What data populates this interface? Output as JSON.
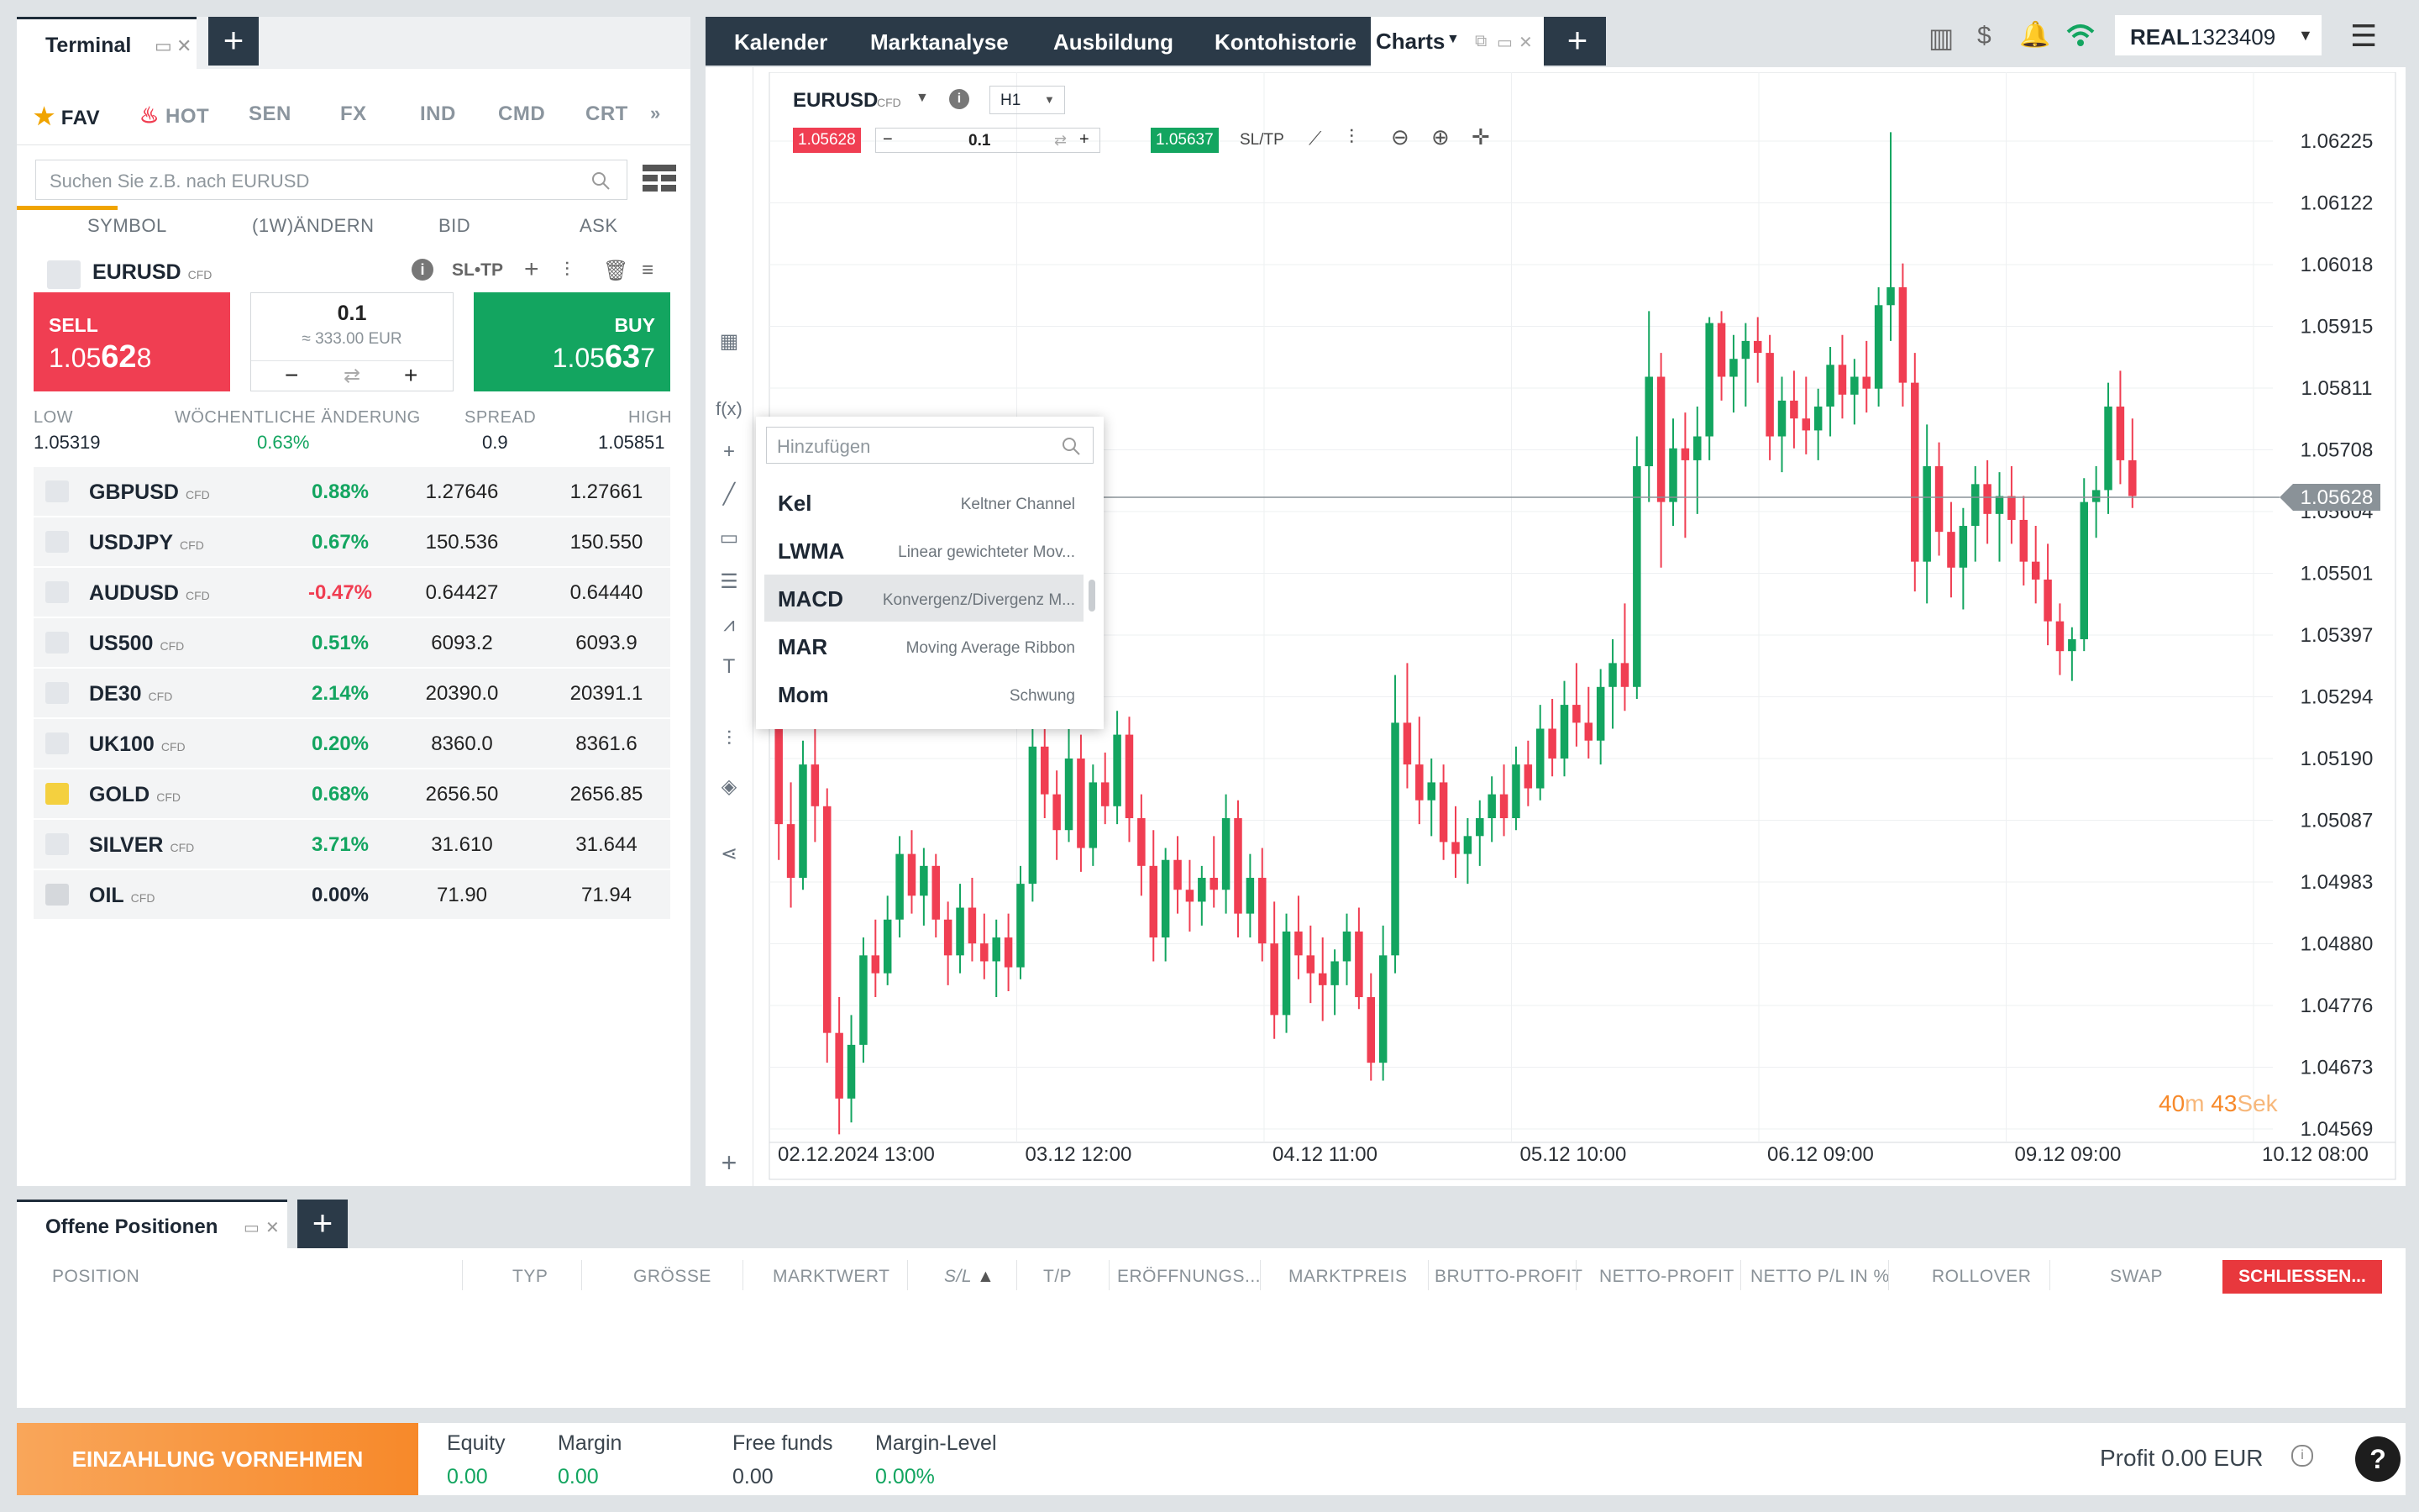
{
  "terminal": {
    "tab_title": "Terminal"
  },
  "categories": [
    {
      "label": "FAV",
      "icon": "star-icon",
      "active": true
    },
    {
      "label": "HOT",
      "icon": "flame-icon"
    },
    {
      "label": "SEN"
    },
    {
      "label": "FX"
    },
    {
      "label": "IND"
    },
    {
      "label": "CMD"
    },
    {
      "label": "CRT"
    }
  ],
  "search": {
    "placeholder": "Suchen Sie z.B. nach EURUSD"
  },
  "columns": {
    "symbol": "SYMBOL",
    "change": "(1W)ÄNDERN",
    "bid": "BID",
    "ask": "ASK"
  },
  "selected": {
    "symbol": "EURUSD",
    "type": "CFD",
    "sltp": "SL•TP",
    "sell_label": "SELL",
    "sell_price_pre": "1.05",
    "sell_price_big": "62",
    "sell_price_post": "8",
    "buy_label": "BUY",
    "buy_price_pre": "1.05",
    "buy_price_big": "63",
    "buy_price_post": "7",
    "volume": "0.1",
    "volume_eur": "≈ 333.00 EUR",
    "minus": "−",
    "plus": "+",
    "low_label": "LOW",
    "low": "1.05319",
    "weekchange_label": "WÖCHENTLICHE ÄNDERUNG",
    "weekchange": "0.63%",
    "spread_label": "SPREAD",
    "spread": "0.9",
    "high_label": "HIGH",
    "high": "1.05851"
  },
  "markets": [
    {
      "name": "GBPUSD",
      "type": "CFD",
      "change": "0.88%",
      "bid": "1.27646",
      "ask": "1.27661",
      "dir": "pos"
    },
    {
      "name": "USDJPY",
      "type": "CFD",
      "change": "0.67%",
      "bid": "150.536",
      "ask": "150.550",
      "dir": "pos"
    },
    {
      "name": "AUDUSD",
      "type": "CFD",
      "change": "-0.47%",
      "bid": "0.64427",
      "ask": "0.64440",
      "dir": "neg"
    },
    {
      "name": "US500",
      "type": "CFD",
      "change": "0.51%",
      "bid": "6093.2",
      "ask": "6093.9",
      "dir": "pos"
    },
    {
      "name": "DE30",
      "type": "CFD",
      "change": "2.14%",
      "bid": "20390.0",
      "ask": "20391.1",
      "dir": "pos"
    },
    {
      "name": "UK100",
      "type": "CFD",
      "change": "0.20%",
      "bid": "8360.0",
      "ask": "8361.6",
      "dir": "pos"
    },
    {
      "name": "GOLD",
      "type": "CFD",
      "change": "0.68%",
      "bid": "2656.50",
      "ask": "2656.85",
      "dir": "pos"
    },
    {
      "name": "SILVER",
      "type": "CFD",
      "change": "3.71%",
      "bid": "31.610",
      "ask": "31.644",
      "dir": "pos"
    },
    {
      "name": "OIL",
      "type": "CFD",
      "change": "0.00%",
      "bid": "71.90",
      "ask": "71.94",
      "dir": "neu"
    }
  ],
  "nav": {
    "items": [
      "Kalender",
      "Marktanalyse",
      "Ausbildung",
      "Kontohistorie"
    ],
    "charts_tab": "Charts",
    "account_type": "REAL",
    "account_number": "1323409"
  },
  "chart_toolbar": {
    "symbol": "EURUSD",
    "type": "CFD",
    "timeframe": "H1",
    "sell_price": "1.05628",
    "buy_price": "1.05637",
    "volume": "0.1",
    "sltp": "SL/TP"
  },
  "indicator_popup": {
    "placeholder": "Hinzufügen",
    "items": [
      {
        "name": "Kel",
        "desc": "Keltner Channel"
      },
      {
        "name": "LWMA",
        "desc": "Linear gewichteter Mov..."
      },
      {
        "name": "MACD",
        "desc": "Konvergenz/Divergenz M...",
        "highlight": true
      },
      {
        "name": "MAR",
        "desc": "Moving Average Ribbon"
      },
      {
        "name": "Mom",
        "desc": "Schwung"
      }
    ]
  },
  "countdown": {
    "minutes": "40",
    "m": "m",
    "seconds": "43",
    "sek": "Sek"
  },
  "chart_data": {
    "type": "candlestick",
    "current_price": "1.05628",
    "y_ticks": [
      "1.06225",
      "1.06122",
      "1.06018",
      "1.05915",
      "1.05811",
      "1.05708",
      "1.05604",
      "1.05501",
      "1.05397",
      "1.05294",
      "1.05190",
      "1.05087",
      "1.04983",
      "1.04880",
      "1.04776",
      "1.04673",
      "1.04569"
    ],
    "ylim": [
      1.04569,
      1.06225
    ],
    "x_ticks": [
      "02.12.2024 13:00",
      "03.12 12:00",
      "04.12 11:00",
      "05.12 10:00",
      "06.12 09:00",
      "09.12 09:00",
      "10.12 08:00"
    ],
    "grid": true,
    "candles": [
      [
        1.0525,
        1.0531,
        1.0502,
        1.0508
      ],
      [
        1.0508,
        1.0515,
        1.0494,
        1.0499
      ],
      [
        1.0499,
        1.0522,
        1.0497,
        1.0518
      ],
      [
        1.0518,
        1.0524,
        1.0505,
        1.0511
      ],
      [
        1.0511,
        1.0514,
        1.0468,
        1.0473
      ],
      [
        1.0473,
        1.0479,
        1.0456,
        1.0462
      ],
      [
        1.0462,
        1.0476,
        1.0458,
        1.0471
      ],
      [
        1.0471,
        1.0489,
        1.0468,
        1.0486
      ],
      [
        1.0486,
        1.0492,
        1.0479,
        1.0483
      ],
      [
        1.0483,
        1.0496,
        1.0481,
        1.0492
      ],
      [
        1.0492,
        1.0506,
        1.0489,
        1.0503
      ],
      [
        1.0503,
        1.0507,
        1.0493,
        1.0496
      ],
      [
        1.0496,
        1.0504,
        1.0491,
        1.0501
      ],
      [
        1.0501,
        1.0503,
        1.0489,
        1.0492
      ],
      [
        1.0492,
        1.0495,
        1.0481,
        1.0486
      ],
      [
        1.0486,
        1.0498,
        1.0483,
        1.0494
      ],
      [
        1.0494,
        1.0499,
        1.0485,
        1.0488
      ],
      [
        1.0488,
        1.0493,
        1.0482,
        1.0485
      ],
      [
        1.0485,
        1.0492,
        1.0479,
        1.0489
      ],
      [
        1.0489,
        1.0493,
        1.048,
        1.0484
      ],
      [
        1.0484,
        1.0501,
        1.0482,
        1.0498
      ],
      [
        1.0498,
        1.0524,
        1.0495,
        1.0521
      ],
      [
        1.0521,
        1.0528,
        1.0509,
        1.0513
      ],
      [
        1.0513,
        1.0517,
        1.0502,
        1.0507
      ],
      [
        1.0507,
        1.0524,
        1.0505,
        1.0519
      ],
      [
        1.0519,
        1.0523,
        1.05,
        1.0504
      ],
      [
        1.0504,
        1.0518,
        1.0501,
        1.0515
      ],
      [
        1.0515,
        1.052,
        1.0508,
        1.0511
      ],
      [
        1.0511,
        1.0527,
        1.0508,
        1.0523
      ],
      [
        1.0523,
        1.0526,
        1.0505,
        1.0509
      ],
      [
        1.0509,
        1.0513,
        1.0496,
        1.0501
      ],
      [
        1.0501,
        1.0507,
        1.0485,
        1.0489
      ],
      [
        1.0489,
        1.0504,
        1.0485,
        1.0502
      ],
      [
        1.0502,
        1.0506,
        1.0493,
        1.0497
      ],
      [
        1.0497,
        1.0502,
        1.049,
        1.0495
      ],
      [
        1.0495,
        1.0501,
        1.0491,
        1.0499
      ],
      [
        1.0499,
        1.0506,
        1.0494,
        1.0497
      ],
      [
        1.0497,
        1.0513,
        1.0493,
        1.0509
      ],
      [
        1.0509,
        1.0512,
        1.0489,
        1.0493
      ],
      [
        1.0493,
        1.0503,
        1.0489,
        1.0499
      ],
      [
        1.0499,
        1.0504,
        1.0485,
        1.0488
      ],
      [
        1.0488,
        1.0495,
        1.0472,
        1.0476
      ],
      [
        1.0476,
        1.0493,
        1.0473,
        1.049
      ],
      [
        1.049,
        1.0496,
        1.0482,
        1.0486
      ],
      [
        1.0486,
        1.0491,
        1.0478,
        1.0483
      ],
      [
        1.0483,
        1.0489,
        1.0475,
        1.0481
      ],
      [
        1.0481,
        1.0487,
        1.0476,
        1.0485
      ],
      [
        1.0485,
        1.0493,
        1.0481,
        1.049
      ],
      [
        1.049,
        1.0494,
        1.0477,
        1.0479
      ],
      [
        1.0479,
        1.0483,
        1.0465,
        1.0468
      ],
      [
        1.0468,
        1.0491,
        1.0465,
        1.0486
      ],
      [
        1.0486,
        1.0533,
        1.0483,
        1.0525
      ],
      [
        1.0525,
        1.0535,
        1.0514,
        1.0518
      ],
      [
        1.0518,
        1.0526,
        1.0508,
        1.0512
      ],
      [
        1.0512,
        1.0519,
        1.0506,
        1.0515
      ],
      [
        1.0515,
        1.0518,
        1.0502,
        1.0505
      ],
      [
        1.0505,
        1.0511,
        1.0499,
        1.0503
      ],
      [
        1.0503,
        1.0509,
        1.0498,
        1.0506
      ],
      [
        1.0506,
        1.0512,
        1.0501,
        1.0509
      ],
      [
        1.0509,
        1.0516,
        1.0505,
        1.0513
      ],
      [
        1.0513,
        1.0518,
        1.0506,
        1.0509
      ],
      [
        1.0509,
        1.0521,
        1.0507,
        1.0518
      ],
      [
        1.0518,
        1.0522,
        1.0511,
        1.0514
      ],
      [
        1.0514,
        1.0528,
        1.0512,
        1.0524
      ],
      [
        1.0524,
        1.0529,
        1.0516,
        1.0519
      ],
      [
        1.0519,
        1.0532,
        1.0516,
        1.0528
      ],
      [
        1.0528,
        1.0535,
        1.0521,
        1.0525
      ],
      [
        1.0525,
        1.0531,
        1.0519,
        1.0522
      ],
      [
        1.0522,
        1.0534,
        1.0518,
        1.0531
      ],
      [
        1.0531,
        1.0539,
        1.0524,
        1.0535
      ],
      [
        1.0535,
        1.0545,
        1.0527,
        1.0531
      ],
      [
        1.0531,
        1.0573,
        1.0529,
        1.0568
      ],
      [
        1.0568,
        1.0594,
        1.0562,
        1.0583
      ],
      [
        1.0583,
        1.0587,
        1.0551,
        1.0562
      ],
      [
        1.0562,
        1.0576,
        1.0558,
        1.0571
      ],
      [
        1.0571,
        1.0577,
        1.0556,
        1.0569
      ],
      [
        1.0569,
        1.0578,
        1.056,
        1.0573
      ],
      [
        1.0573,
        1.0593,
        1.0569,
        1.0592
      ],
      [
        1.0592,
        1.0594,
        1.0579,
        1.0583
      ],
      [
        1.0583,
        1.059,
        1.0577,
        1.0586
      ],
      [
        1.0586,
        1.0592,
        1.0578,
        1.0589
      ],
      [
        1.0589,
        1.0593,
        1.0582,
        1.0587
      ],
      [
        1.0587,
        1.059,
        1.0569,
        1.0573
      ],
      [
        1.0573,
        1.0583,
        1.0567,
        1.0579
      ],
      [
        1.0579,
        1.0584,
        1.0571,
        1.0576
      ],
      [
        1.0576,
        1.0583,
        1.057,
        1.0574
      ],
      [
        1.0574,
        1.0581,
        1.0569,
        1.0578
      ],
      [
        1.0578,
        1.0588,
        1.0573,
        1.0585
      ],
      [
        1.0585,
        1.059,
        1.0576,
        1.058
      ],
      [
        1.058,
        1.0586,
        1.0575,
        1.0583
      ],
      [
        1.0583,
        1.0589,
        1.0577,
        1.0581
      ],
      [
        1.0581,
        1.0598,
        1.0578,
        1.0595
      ],
      [
        1.0595,
        1.0624,
        1.0589,
        1.0598
      ],
      [
        1.0598,
        1.0602,
        1.0578,
        1.0582
      ],
      [
        1.0582,
        1.0587,
        1.0547,
        1.0552
      ],
      [
        1.0552,
        1.0575,
        1.0545,
        1.0568
      ],
      [
        1.0568,
        1.0572,
        1.0553,
        1.0557
      ],
      [
        1.0557,
        1.0562,
        1.0546,
        1.0551
      ],
      [
        1.0551,
        1.0561,
        1.0544,
        1.0558
      ],
      [
        1.0558,
        1.0568,
        1.0552,
        1.0565
      ],
      [
        1.0565,
        1.0569,
        1.0555,
        1.056
      ],
      [
        1.056,
        1.0567,
        1.0552,
        1.0563
      ],
      [
        1.0563,
        1.0568,
        1.0555,
        1.0559
      ],
      [
        1.0559,
        1.0563,
        1.0548,
        1.0552
      ],
      [
        1.0552,
        1.0558,
        1.0545,
        1.0549
      ],
      [
        1.0549,
        1.0555,
        1.0538,
        1.0542
      ],
      [
        1.0542,
        1.0545,
        1.0533,
        1.0537
      ],
      [
        1.0537,
        1.0541,
        1.0532,
        1.0539
      ],
      [
        1.0539,
        1.0566,
        1.0537,
        1.0562
      ],
      [
        1.0562,
        1.0568,
        1.0556,
        1.0564
      ],
      [
        1.0564,
        1.0582,
        1.056,
        1.0578
      ],
      [
        1.0578,
        1.0584,
        1.0565,
        1.0569
      ],
      [
        1.0569,
        1.0576,
        1.0561,
        1.0563
      ]
    ]
  },
  "positions": {
    "tab_title": "Offene Positionen",
    "columns": [
      "POSITION",
      "TYP",
      "GRÖSSE",
      "MARKTWERT",
      "S/L",
      "T/P",
      "ERÖFFNUNGS...",
      "MARKTPREIS",
      "BRUTTO-PROFIT",
      "NETTO-PROFIT",
      "NETTO P/L IN %",
      "ROLLOVER",
      "SWAP"
    ],
    "close_button": "SCHLIESSEN..."
  },
  "footer": {
    "deposit_button": "EINZAHLUNG VORNEHMEN",
    "equity_label": "Equity",
    "equity": "0.00",
    "margin_label": "Margin",
    "margin": "0.00",
    "free_label": "Free funds",
    "free": "0.00",
    "level_label": "Margin-Level",
    "level": "0.00%",
    "profit": "Profit 0.00 EUR",
    "help": "?"
  },
  "colors": {
    "buy": "#13a560",
    "sell": "#f03e52",
    "accent": "#f0a400",
    "nav": "#2b3a48",
    "deposit": "#f7892a"
  }
}
